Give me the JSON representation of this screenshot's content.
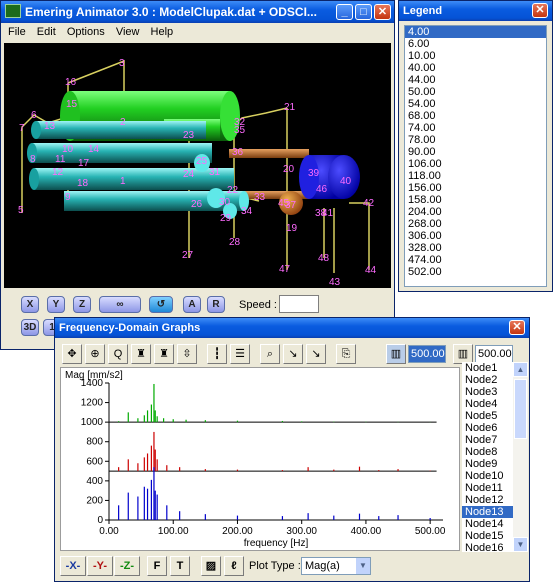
{
  "animator": {
    "title": "Emering Animator 3.0 : ModelClupak.dat + ODSCI...",
    "menu": [
      "File",
      "Edit",
      "Options",
      "View",
      "Help"
    ],
    "axis_buttons": [
      "X",
      "Y",
      "Z"
    ],
    "btn_a": "A",
    "btn_r": "R",
    "btn_3d": "3D",
    "btn_1": "1",
    "speed_label": "Speed :",
    "labels": [
      "1",
      "2",
      "3",
      "5",
      "6",
      "7",
      "8",
      "9",
      "10",
      "11",
      "12",
      "13",
      "14",
      "15",
      "16",
      "17",
      "18",
      "19",
      "20",
      "21",
      "22",
      "23",
      "24",
      "25",
      "26",
      "27",
      "28",
      "29",
      "30",
      "31",
      "32",
      "33",
      "34",
      "35",
      "36",
      "37",
      "38",
      "39",
      "40",
      "41",
      "42",
      "43",
      "44",
      "45",
      "46",
      "47",
      "48"
    ]
  },
  "legend": {
    "title": "Legend",
    "items": [
      "4.00",
      "6.00",
      "10.00",
      "40.00",
      "44.00",
      "50.00",
      "54.00",
      "68.00",
      "74.00",
      "78.00",
      "90.00",
      "106.00",
      "118.00",
      "156.00",
      "158.00",
      "204.00",
      "268.00",
      "306.00",
      "328.00",
      "474.00",
      "502.00"
    ],
    "selected_index": 0
  },
  "freq": {
    "title": "Frequency-Domain Graphs",
    "box1_value": "500.00",
    "box2_value": "500.00",
    "node_list": [
      "Node1",
      "Node2",
      "Node3",
      "Node4",
      "Node5",
      "Node6",
      "Node7",
      "Node8",
      "Node9",
      "Node10",
      "Node11",
      "Node12",
      "Node13",
      "Node14",
      "Node15",
      "Node16"
    ],
    "selected_node_index": 12,
    "bottom_buttons": [
      "-X-",
      "-Y-",
      "-Z-",
      "F",
      "T"
    ],
    "plot_type_label": "Plot Type :",
    "plot_type_value": "Mag(a)"
  },
  "colors": {
    "green_trace": "#00aa00",
    "red_trace": "#cc0000",
    "blue_trace": "#0000cc",
    "title_blue": "#0a5ce0",
    "selection": "#316ac5"
  },
  "chart_data": {
    "type": "line",
    "ylabel": "Mag [mm/s2]",
    "xlabel": "frequency [Hz]",
    "xlim": [
      0,
      520
    ],
    "ylim": [
      0,
      1400
    ],
    "x_ticks": [
      "0.00",
      "100.00",
      "200.00",
      "300.00",
      "400.00",
      "500.00"
    ],
    "y_ticks": [
      "0",
      "200",
      "400",
      "600",
      "800",
      "1000",
      "1200",
      "1400"
    ],
    "series": [
      {
        "color": "#00aa00",
        "baseline": 1000,
        "x": [
          0,
          15,
          30,
          45,
          55,
          60,
          66,
          70,
          72,
          75,
          85,
          100,
          120,
          150,
          200,
          270,
          300,
          350,
          400,
          450,
          500
        ],
        "y": [
          1000,
          1010,
          1100,
          1040,
          1070,
          1120,
          1180,
          1390,
          1120,
          1060,
          1040,
          1030,
          1025,
          1020,
          1015,
          1012,
          1008,
          1005,
          1004,
          1003,
          1002
        ]
      },
      {
        "color": "#cc0000",
        "baseline": 500,
        "x": [
          0,
          15,
          30,
          45,
          55,
          60,
          66,
          70,
          72,
          75,
          90,
          110,
          150,
          200,
          270,
          310,
          350,
          390,
          420,
          450,
          500
        ],
        "y": [
          500,
          540,
          620,
          580,
          640,
          680,
          760,
          900,
          720,
          620,
          560,
          540,
          520,
          515,
          510,
          540,
          515,
          545,
          510,
          520,
          505
        ]
      },
      {
        "color": "#0000cc",
        "baseline": 0,
        "x": [
          0,
          15,
          30,
          45,
          55,
          60,
          66,
          70,
          72,
          75,
          90,
          110,
          150,
          200,
          270,
          310,
          350,
          390,
          420,
          450,
          500
        ],
        "y": [
          0,
          150,
          280,
          240,
          340,
          320,
          410,
          540,
          300,
          260,
          150,
          90,
          60,
          45,
          40,
          70,
          45,
          65,
          40,
          50,
          20
        ]
      }
    ]
  }
}
